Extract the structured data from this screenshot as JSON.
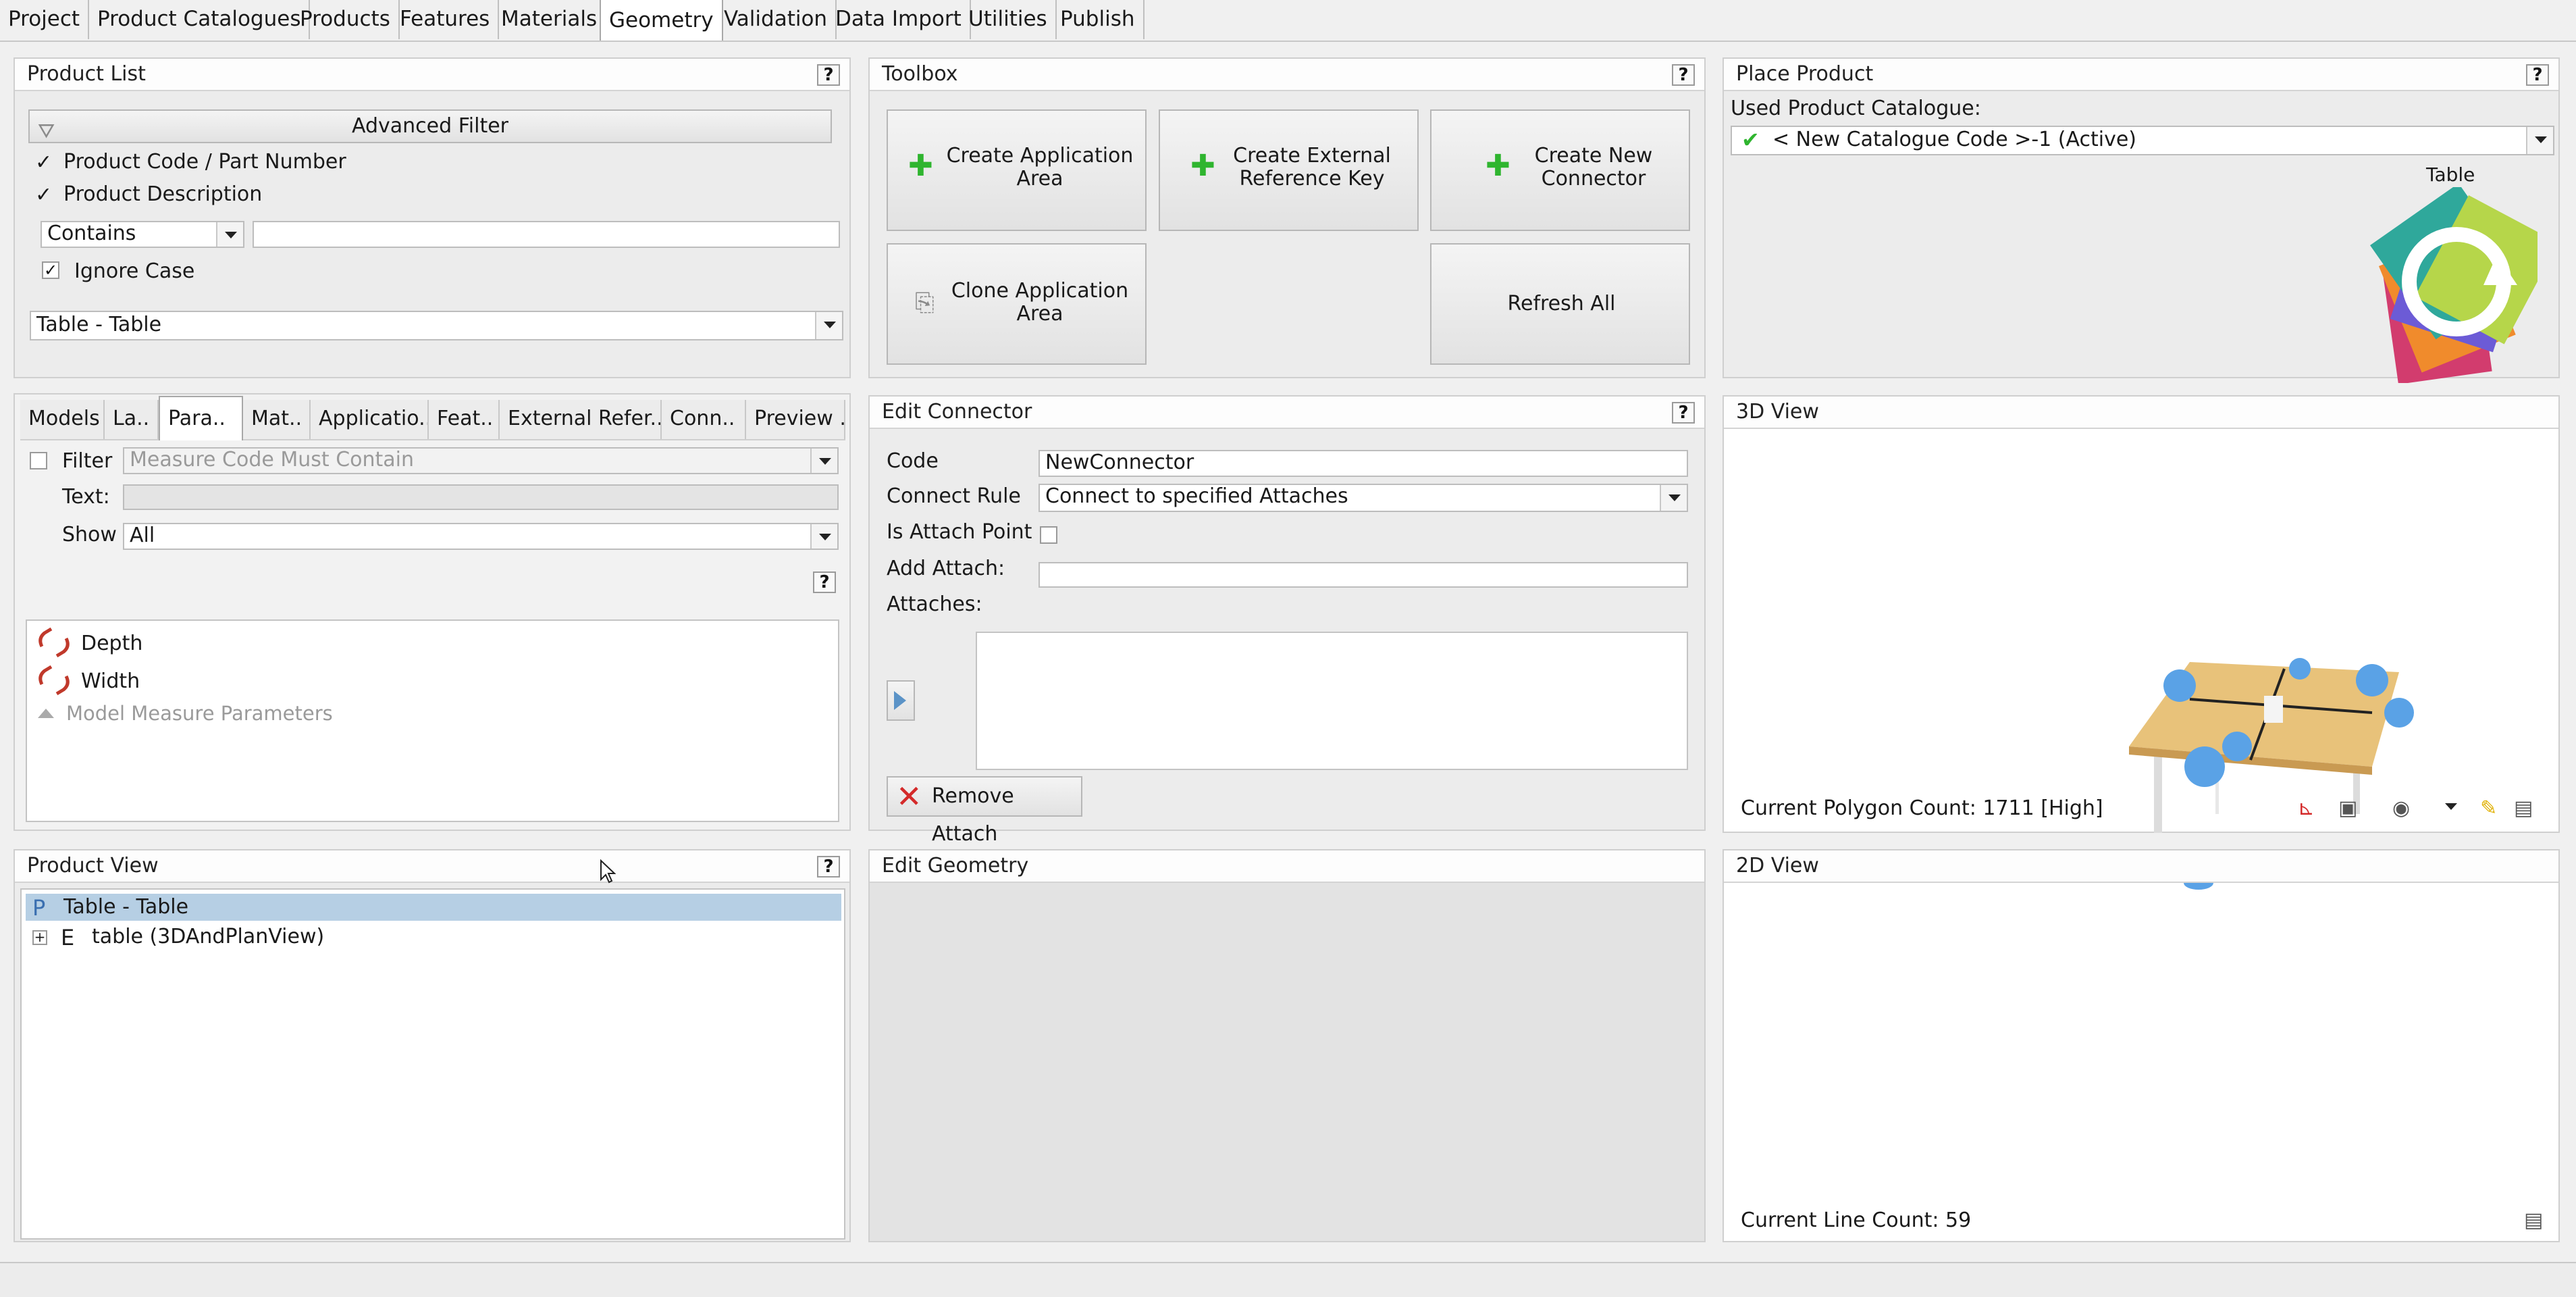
{
  "top_tabs": [
    {
      "label": "Project"
    },
    {
      "label": "Product Catalogues"
    },
    {
      "label": "Products"
    },
    {
      "label": "Features"
    },
    {
      "label": "Materials"
    },
    {
      "label": "Geometry"
    },
    {
      "label": "Validation"
    },
    {
      "label": "Data Import"
    },
    {
      "label": "Utilities"
    },
    {
      "label": "Publish"
    }
  ],
  "active_top_tab": "Geometry",
  "product_list": {
    "title": "Product List",
    "help": "?",
    "advanced_filter": "Advanced Filter",
    "chk_code_label": "Product Code / Part Number",
    "chk_desc_label": "Product Description",
    "match_mode": "Contains",
    "search_value": "",
    "ignore_case_label": "Ignore Case",
    "selected_product": "Table - Table"
  },
  "toolbox": {
    "title": "Toolbox",
    "help": "?",
    "btn_create_app_area": "Create Application Area",
    "btn_create_ext_ref": "Create External Reference Key",
    "btn_create_connector": "Create New Connector",
    "btn_clone_app_area": "Clone Application Area",
    "btn_refresh_all": "Refresh All"
  },
  "place_product": {
    "title": "Place Product",
    "help": "?",
    "used_catalogue_label": "Used Product Catalogue:",
    "catalogue_value": "< New Catalogue Code >-1 (Active)",
    "thumb_label": "Table"
  },
  "sub_tabs": [
    {
      "label": "Models"
    },
    {
      "label": "La.."
    },
    {
      "label": "Para.."
    },
    {
      "label": "Mat.."
    },
    {
      "label": "Applicatio.."
    },
    {
      "label": "Feat.."
    },
    {
      "label": "External Refer.."
    },
    {
      "label": "Conn.."
    },
    {
      "label": "Preview .."
    }
  ],
  "parameters": {
    "filter_label": "Filter",
    "filter_placeholder": "Measure Code Must Contain",
    "text_label": "Text:",
    "show_label": "Show",
    "show_value": "All",
    "help": "?",
    "items": [
      {
        "label": "Depth"
      },
      {
        "label": "Width"
      }
    ],
    "group_label": "Model Measure Parameters"
  },
  "edit_connector": {
    "title": "Edit Connector",
    "help": "?",
    "code_label": "Code",
    "code_value": "NewConnector",
    "connect_rule_label": "Connect Rule",
    "connect_rule_value": "Connect to specified Attaches",
    "is_attach_label": "Is Attach Point",
    "add_attach_label": "Add Attach:",
    "add_attach_value": "",
    "attaches_label": "Attaches:",
    "remove_attach": "Remove Attach"
  },
  "view3d": {
    "title": "3D View",
    "polygon_count": "Current Polygon Count: 1711 [High]"
  },
  "product_view": {
    "title": "Product View",
    "help": "?",
    "root_icon": "P",
    "root_label": "Table - Table",
    "child_icon": "E",
    "child_label": "table (3DAndPlanView)"
  },
  "edit_geometry": {
    "title": "Edit Geometry"
  },
  "view2d": {
    "title": "2D View",
    "line_count": "Current Line Count: 59"
  },
  "colors": {
    "accent_green": "#2fb52f",
    "selection": "#b6cfe4",
    "remove_red": "#d42a2a",
    "wood": "#e8c27a",
    "connector_blue": "#5aa2e6"
  }
}
